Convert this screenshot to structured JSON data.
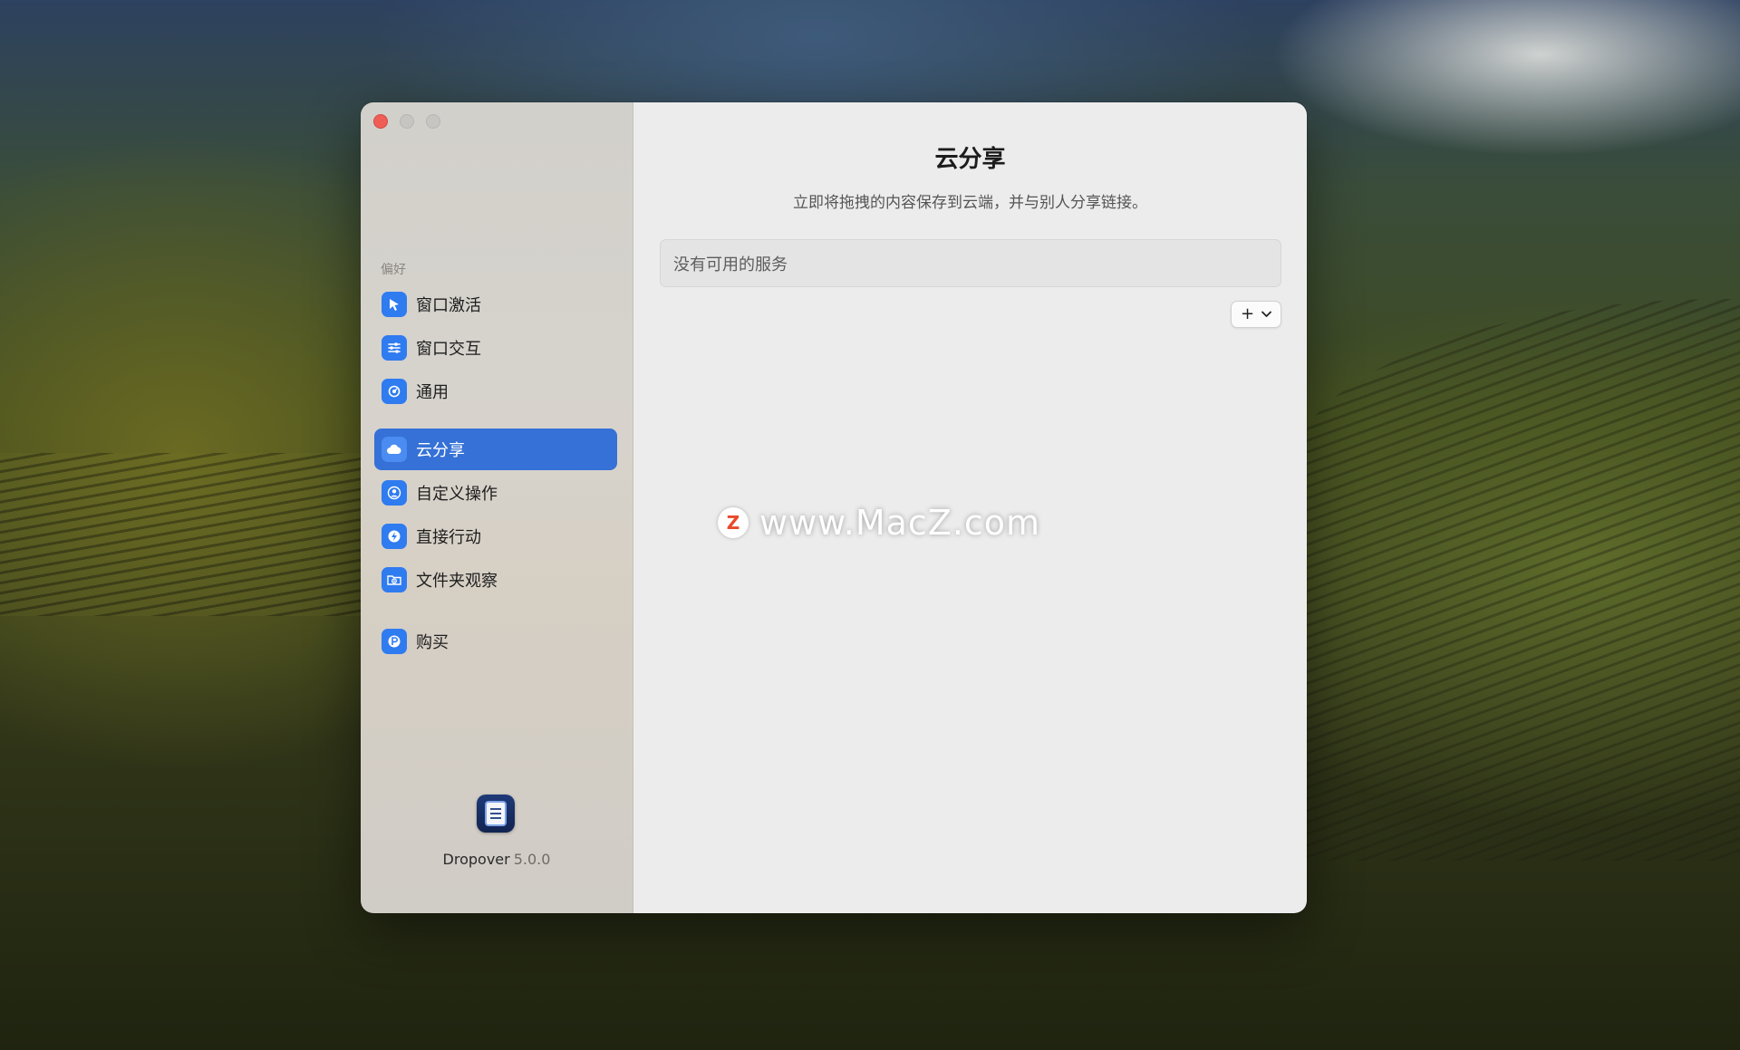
{
  "window": {
    "controls": [
      "close",
      "minimize",
      "maximize"
    ]
  },
  "sidebar": {
    "section_label": "偏好",
    "groups": [
      {
        "items": [
          {
            "label": "窗口激活",
            "icon": "cursor-icon"
          },
          {
            "label": "窗口交互",
            "icon": "sliders-icon"
          },
          {
            "label": "通用",
            "icon": "gear-icon"
          }
        ]
      },
      {
        "items": [
          {
            "label": "云分享",
            "icon": "cloud-icon",
            "selected": true
          },
          {
            "label": "自定义操作",
            "icon": "person-icon"
          },
          {
            "label": "直接行动",
            "icon": "bolt-icon"
          },
          {
            "label": "文件夹观察",
            "icon": "folder-eye-icon"
          }
        ]
      },
      {
        "items": [
          {
            "label": "购买",
            "icon": "purchase-icon"
          }
        ]
      }
    ],
    "app_name": "Dropover",
    "app_version": "5.0.0"
  },
  "main": {
    "title": "云分享",
    "subtitle": "立即将拖拽的内容保存到云端，并与别人分享链接。",
    "services_empty": "没有可用的服务",
    "add_button": {
      "plus": "+",
      "chevron": "⌄"
    }
  },
  "watermark": {
    "logo": "Z",
    "text": "www.MacZ.com"
  },
  "colors": {
    "accent": "#3571d6",
    "icon_blue": "#2f7bf0",
    "close": "#ee5e56"
  }
}
